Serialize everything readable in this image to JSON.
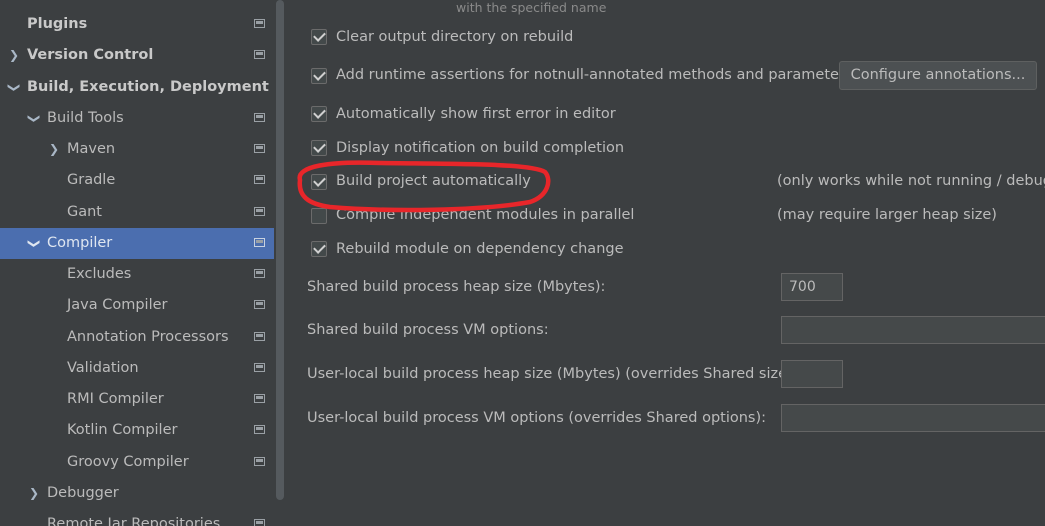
{
  "sidebar": {
    "items": [
      {
        "label": "Plugins",
        "level": 0,
        "arrow": "",
        "bold": true,
        "proj": true
      },
      {
        "label": "Version Control",
        "level": 0,
        "arrow": "right",
        "bold": true,
        "proj": true
      },
      {
        "label": "Build, Execution, Deployment",
        "level": 0,
        "arrow": "down",
        "bold": true,
        "proj": false
      },
      {
        "label": "Build Tools",
        "level": 1,
        "arrow": "down",
        "bold": false,
        "proj": true
      },
      {
        "label": "Maven",
        "level": 2,
        "arrow": "right",
        "bold": false,
        "proj": true
      },
      {
        "label": "Gradle",
        "level": 2,
        "arrow": "",
        "bold": false,
        "proj": true
      },
      {
        "label": "Gant",
        "level": 2,
        "arrow": "",
        "bold": false,
        "proj": true
      },
      {
        "label": "Compiler",
        "level": 1,
        "arrow": "down",
        "bold": false,
        "proj": true,
        "selected": true
      },
      {
        "label": "Excludes",
        "level": 2,
        "arrow": "",
        "bold": false,
        "proj": true
      },
      {
        "label": "Java Compiler",
        "level": 2,
        "arrow": "",
        "bold": false,
        "proj": true
      },
      {
        "label": "Annotation Processors",
        "level": 2,
        "arrow": "",
        "bold": false,
        "proj": true
      },
      {
        "label": "Validation",
        "level": 2,
        "arrow": "",
        "bold": false,
        "proj": true
      },
      {
        "label": "RMI Compiler",
        "level": 2,
        "arrow": "",
        "bold": false,
        "proj": true
      },
      {
        "label": "Kotlin Compiler",
        "level": 2,
        "arrow": "",
        "bold": false,
        "proj": true
      },
      {
        "label": "Groovy Compiler",
        "level": 2,
        "arrow": "",
        "bold": false,
        "proj": true
      },
      {
        "label": "Debugger",
        "level": 1,
        "arrow": "right",
        "bold": false,
        "proj": false
      },
      {
        "label": "Remote Jar Repositories",
        "level": 1,
        "arrow": "",
        "bold": false,
        "proj": true
      }
    ]
  },
  "main": {
    "faded_text": "with the specified name",
    "checkboxes": [
      {
        "label": "Clear output directory on rebuild",
        "checked": true
      },
      {
        "label": "Add runtime assertions for notnull-annotated methods and parameters",
        "checked": true
      },
      {
        "label": "Automatically show first error in editor",
        "checked": true
      },
      {
        "label": "Display notification on build completion",
        "checked": true
      },
      {
        "label": "Build project automatically",
        "checked": true
      },
      {
        "label": "Compile independent modules in parallel",
        "checked": false
      },
      {
        "label": "Rebuild module on dependency change",
        "checked": true
      }
    ],
    "configure_button": "Configure annotations...",
    "hints": {
      "build_auto": "(only works while not running / debugging)",
      "parallel": "(may require larger heap size)"
    },
    "fields": {
      "shared_heap_label": "Shared build process heap size (Mbytes):",
      "shared_heap_value": "700",
      "shared_vm_label": "Shared build process VM options:",
      "shared_vm_value": "",
      "local_heap_label": "User-local build process heap size (Mbytes) (overrides Shared size):",
      "local_heap_value": "",
      "local_vm_label": "User-local build process VM options (overrides Shared options):",
      "local_vm_value": ""
    }
  },
  "colors": {
    "selection": "#4b6eaf",
    "annotation": "#e8262a",
    "background": "#3c3f41"
  }
}
